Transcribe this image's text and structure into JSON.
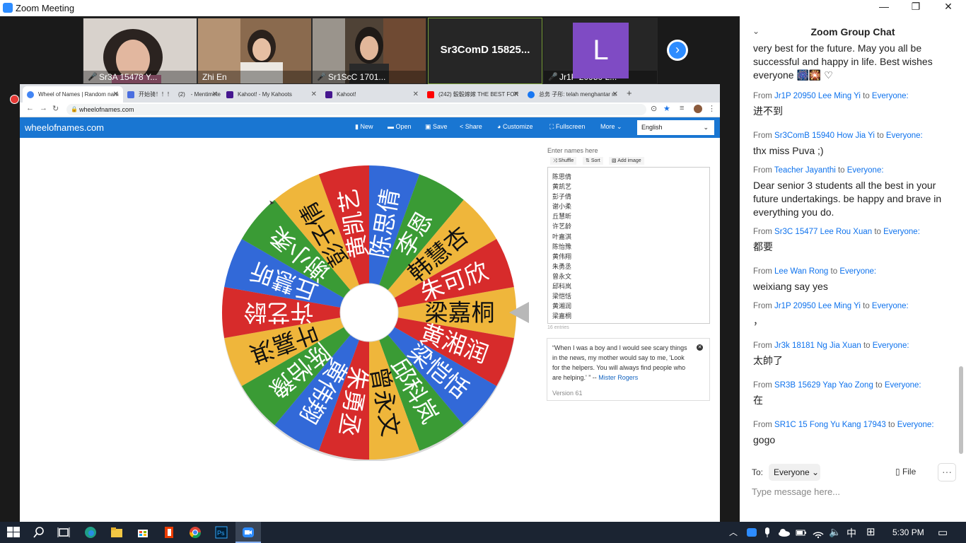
{
  "window": {
    "title": "Zoom Meeting",
    "controls": {
      "minimize": "—",
      "maximize": "❐",
      "close": "✕"
    }
  },
  "participants": [
    {
      "name": "Sr3A 15478 Y...",
      "muted": true
    },
    {
      "name": "Zhi En",
      "muted": false
    },
    {
      "name": "Sr1ScC 1701...",
      "muted": true
    },
    {
      "name": "Sr3ComD 15825...",
      "muted": false,
      "video": false
    },
    {
      "name": "Jr1P 20950 L...",
      "muted": true,
      "avatar_letter": "L"
    }
  ],
  "browser": {
    "tabs": [
      {
        "label": "Wheel of Names | Random nam",
        "active": true
      },
      {
        "label": "开始骑！！！　(2)　- Mentimete"
      },
      {
        "label": "Kahoot! - My Kahoots"
      },
      {
        "label": "Kahoot!"
      },
      {
        "label": "(242) 骰骰嫁嫁 THE BEST FOR"
      },
      {
        "label": "总务 子彤: telah menghantar m"
      }
    ],
    "new_tab": "+",
    "url": "wheelofnames.com"
  },
  "wheelofnames": {
    "brand": "wheelofnames.com",
    "menu": [
      "New",
      "Open",
      "Save",
      "Share",
      "Customize",
      "Fullscreen",
      "More"
    ],
    "language": "English",
    "entries_label": "Enter names here",
    "shuffle_label": "Shuffle",
    "sort_label": "Sort",
    "add_image_label": "Add image",
    "entries": [
      "陈思倩",
      "黄凯艺",
      "彭子倩",
      "谢小柔",
      "丘慧昕",
      "许艺龄",
      "叶嘉淇",
      "陈怡豫",
      "黄伟翔",
      "朱勇丞",
      "曾永文",
      "邱科岚",
      "梁恺恬",
      "黄湘润",
      "梁嘉桐",
      "朱可欣"
    ],
    "entries_count": "16 entries",
    "quote_text": "“When I was a boy and I would see scary things in the news, my mother would say to me, 'Look for the helpers. You will always find people who are helping.' ” --",
    "quote_author": "Mister Rogers",
    "version": "Version 61",
    "wheel_segments": [
      "梁嘉桐",
      "黄湘润",
      "梁恺恬",
      "邱科岚",
      "曾永文",
      "朱勇丞",
      "黄伟翔",
      "陈怡豫",
      "叶嘉淇",
      "许艺龄",
      "丘慧昕",
      "谢小柔",
      "彭子倩",
      "黄凯艺",
      "陈思倩",
      "李恩",
      "韩慧杏",
      "朱可欣"
    ],
    "wheel_colors": {
      "yellow": "#efb63b",
      "red": "#d72b2b",
      "green": "#3a9b35",
      "blue": "#3269d8"
    }
  },
  "chat": {
    "title": "Zoom Group Chat",
    "messages": [
      {
        "from": "",
        "to": "",
        "body": "very best for the future. May you all be successful and happy in life. Best wishes everyone 🎆🎇 ♡"
      },
      {
        "from": "Jr1P 20950 Lee Ming Yi",
        "to": "Everyone:",
        "body": "进不到"
      },
      {
        "from": "Sr3ComB 15940 How Jia Yi",
        "to": "Everyone:",
        "body": "thx miss Puva ;)"
      },
      {
        "from": "Teacher Jayanthi",
        "to": "Everyone:",
        "body": "Dear senior 3 students all the best in your future undertakings. be happy and brave in everything you do."
      },
      {
        "from": "Sr3C 15477 Lee Rou Xuan",
        "to": "Everyone:",
        "body": "都要"
      },
      {
        "from": "Lee Wan Rong",
        "to": "Everyone:",
        "body": "weixiang say yes"
      },
      {
        "from": "Jr1P 20950 Lee Ming Yi",
        "to": "Everyone:",
        "body": "，"
      },
      {
        "from": "Jr3k 18181 Ng Jia Xuan",
        "to": "Everyone:",
        "body": "太帥了"
      },
      {
        "from": "SR3B 15629 Yap Yao Zong",
        "to": "Everyone:",
        "body": "在"
      },
      {
        "from": "SR1C 15 Fong Yu Kang 17943",
        "to": "Everyone:",
        "body": "gogo"
      }
    ],
    "from_prefix": "From",
    "to_word": "to",
    "to_label": "To:",
    "recipient": "Everyone",
    "file_label": "File",
    "more_label": "···",
    "input_placeholder": "Type message here..."
  },
  "taskbar": {
    "ime": "中",
    "time": "5:30 PM"
  }
}
